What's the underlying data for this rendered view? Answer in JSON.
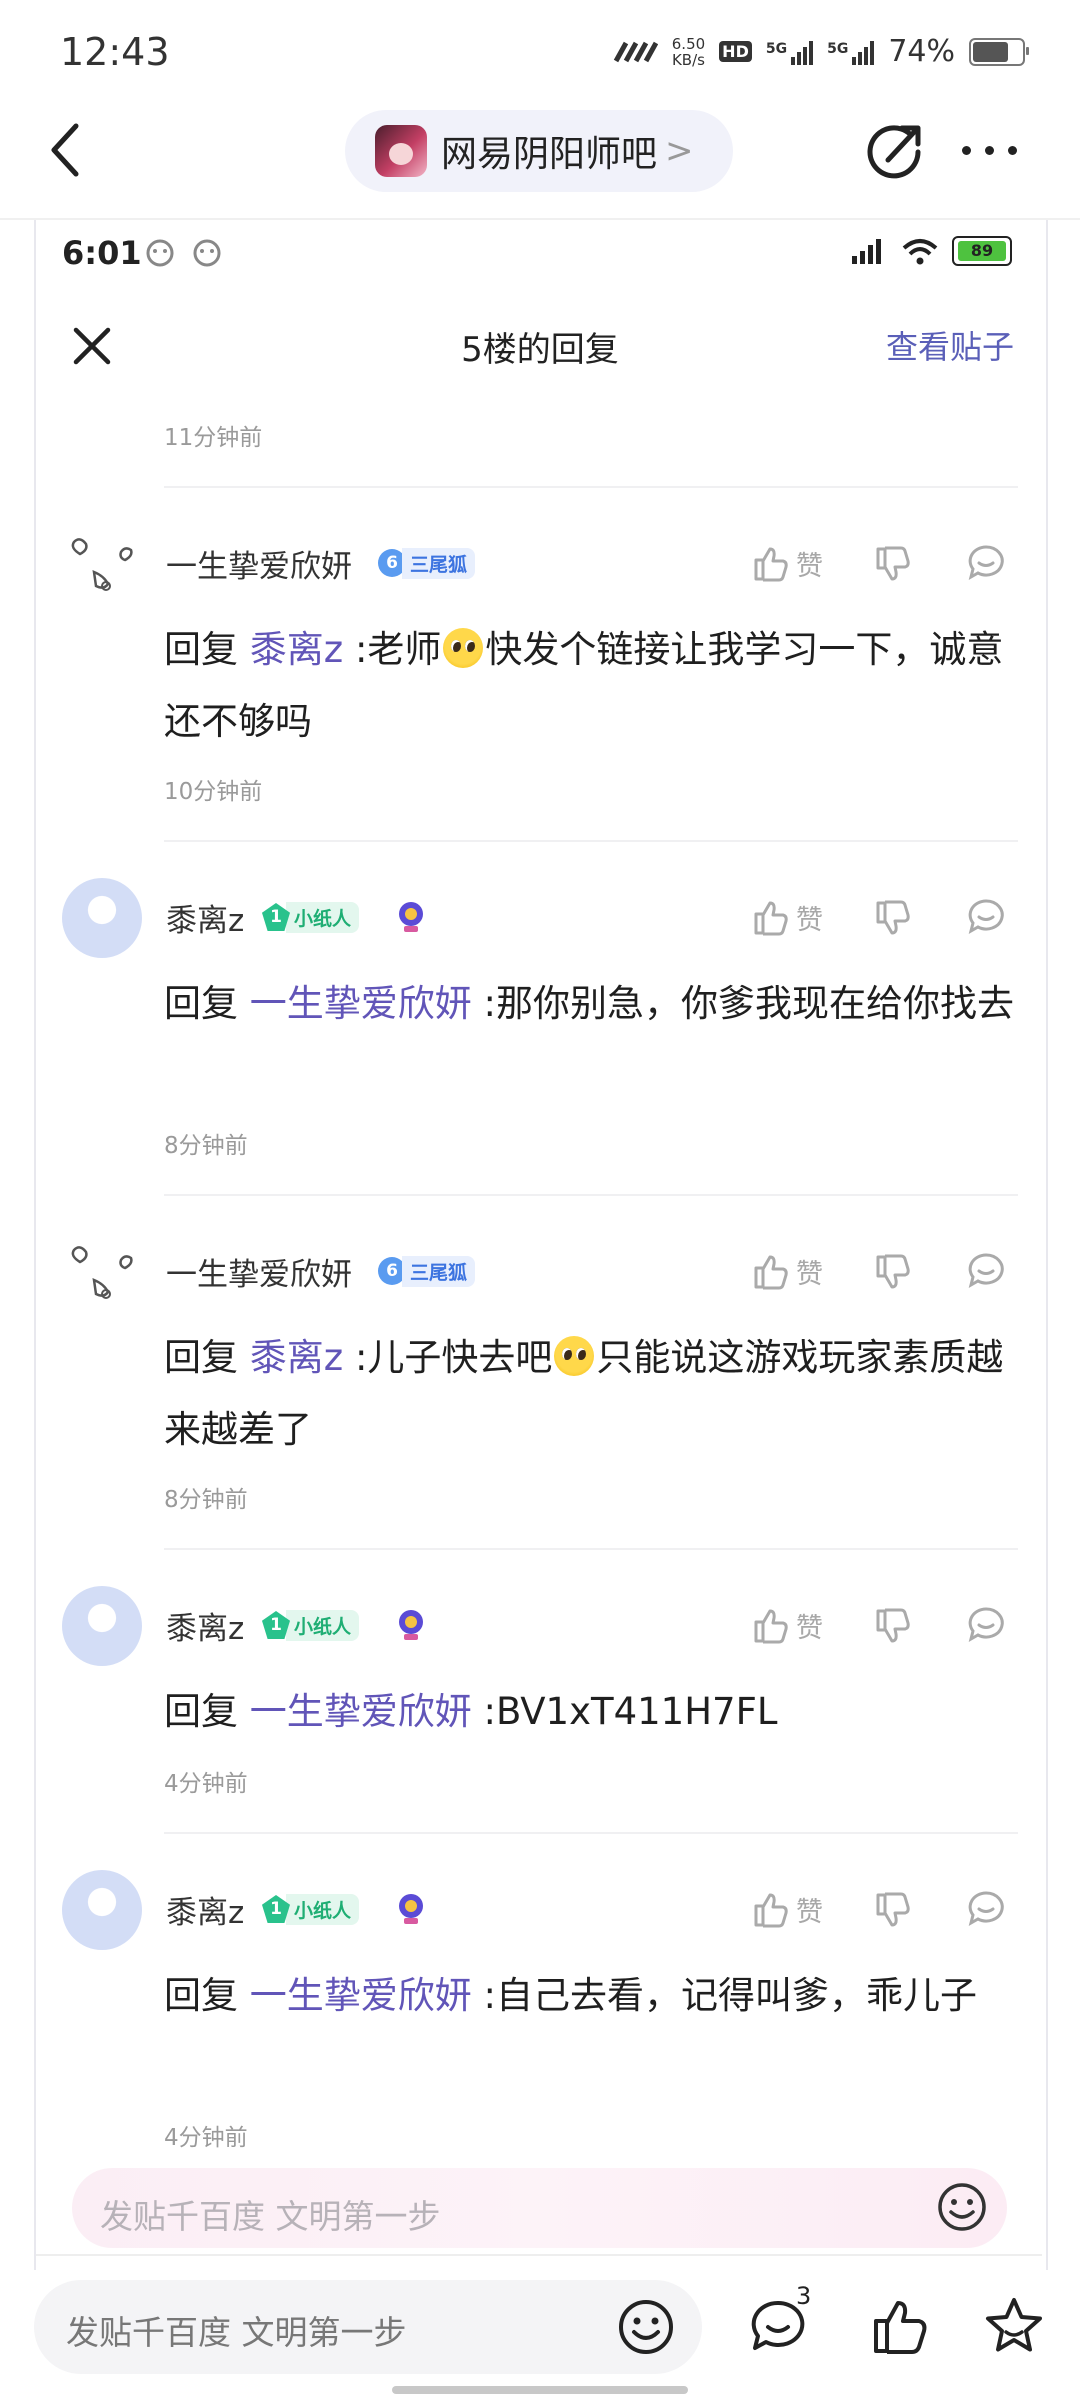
{
  "status_bar": {
    "time": "12:43",
    "net_speed_value": "6.50",
    "net_speed_unit": "KB/s",
    "hd_badge": "HD",
    "network_label_1": "5G",
    "network_label_2": "5G",
    "battery_text": "74%",
    "battery_level": 0.74
  },
  "nav": {
    "forum_name": "网易阴阳师吧",
    "forum_chevron": ">"
  },
  "inner_status": {
    "time": "6:01",
    "battery": "89"
  },
  "header": {
    "title": "5楼的回复",
    "view_post": "查看贴子"
  },
  "prev_time": "11分钟前",
  "comments": [
    {
      "user": "一生挚爱欣妍",
      "level": "6",
      "level_title": "三尾狐",
      "like_label": "赞",
      "reply_prefix": "回复",
      "mention": "黍离z",
      "text_a": " :老师",
      "text_b": "快发个链接让我学习一下，诚意还不够吗",
      "time": "10分钟前"
    },
    {
      "user": "黍离z",
      "level": "1",
      "level_title": "小纸人",
      "like_label": "赞",
      "reply_prefix": "回复",
      "mention": "一生挚爱欣妍",
      "text": " :那你别急，你爹我现在给你找去",
      "time": "8分钟前"
    },
    {
      "user": "一生挚爱欣妍",
      "level": "6",
      "level_title": "三尾狐",
      "like_label": "赞",
      "reply_prefix": "回复",
      "mention": "黍离z",
      "text_a": " :儿子快去吧",
      "text_b": "只能说这游戏玩家素质越来越差了",
      "time": "8分钟前"
    },
    {
      "user": "黍离z",
      "level": "1",
      "level_title": "小纸人",
      "like_label": "赞",
      "reply_prefix": "回复",
      "mention": "一生挚爱欣妍",
      "text": " :BV1xT411H7FL",
      "time": "4分钟前"
    },
    {
      "user": "黍离z",
      "level": "1",
      "level_title": "小纸人",
      "like_label": "赞",
      "reply_prefix": "回复",
      "mention": "一生挚爱欣妍",
      "text": " :自己去看，记得叫爹，乖儿子",
      "time": "4分钟前"
    }
  ],
  "inner_input": {
    "placeholder": "发贴千百度 文明第一步"
  },
  "bottom_bar": {
    "placeholder": "发贴千百度 文明第一步",
    "comment_count": "3"
  },
  "icons": {
    "back": "chevron-left-icon",
    "share": "share-icon",
    "more": "more-dots-icon",
    "close": "close-icon",
    "like": "thumbs-up-icon",
    "dislike": "thumbs-down-icon",
    "reply": "comment-icon",
    "emoji": "smile-icon",
    "favorite": "star-icon"
  },
  "colors": {
    "accent": "#5a5fb8",
    "mention": "#6155b8",
    "level6": "#5a9bf0",
    "level1": "#29c28c"
  }
}
